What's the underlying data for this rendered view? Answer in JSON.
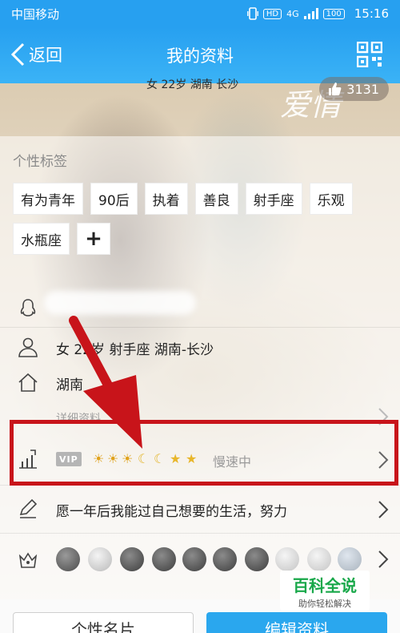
{
  "status_bar": {
    "operator": "中国移动",
    "hd": "HD",
    "net": "4G",
    "battery": "100",
    "time": "15:16"
  },
  "header": {
    "back_label": "返回",
    "title": "我的资料"
  },
  "banner": {
    "summary": "女 22岁 湖南 长沙",
    "likes": "3131",
    "script": "爱情"
  },
  "tags": {
    "title": "个性标签",
    "items": [
      "有为青年",
      "90后",
      "执着",
      "善良",
      "射手座",
      "乐观",
      "水瓶座"
    ],
    "add_label": "+"
  },
  "info": {
    "basic": "女 22岁 射手座 湖南-长沙",
    "hometown": "湖南",
    "detail_link": "详细资料"
  },
  "vip": {
    "badge": "VIP",
    "speed": "慢速中"
  },
  "signature": {
    "text": "愿一年后我能过自己想要的生活，努力"
  },
  "bottom": {
    "card_label": "个性名片",
    "edit_label": "编辑资料"
  },
  "watermark": {
    "logo": "百科全说",
    "subtitle": "助你轻松解决"
  },
  "colors": {
    "accent": "#27a0f0",
    "highlight": "#c8141a",
    "vip_gray": "#b5b5b5",
    "watermark_green": "#19a84a"
  }
}
